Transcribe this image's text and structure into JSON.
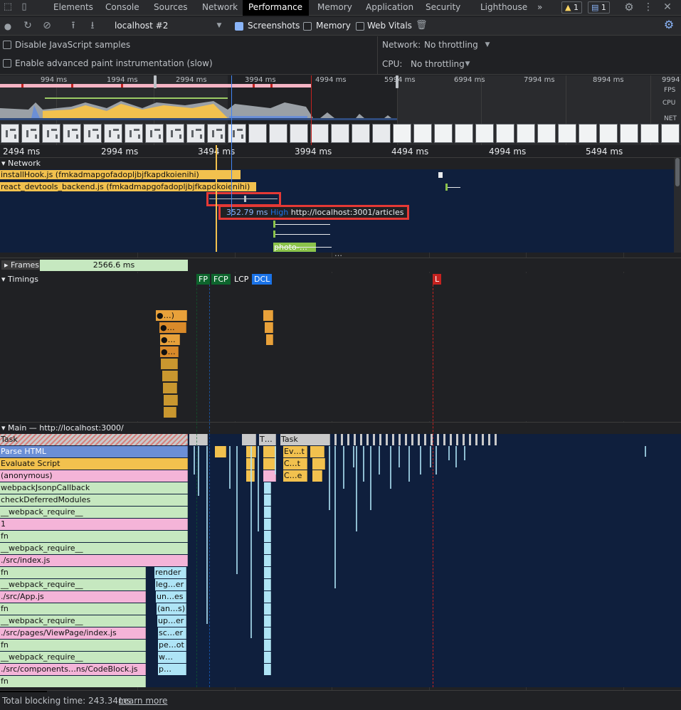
{
  "tabs": {
    "items": [
      "Elements",
      "Console",
      "Sources",
      "Network",
      "Performance",
      "Memory",
      "Application",
      "Security",
      "Lighthouse"
    ],
    "more": "»",
    "warnings_count": "1",
    "messages_count": "1"
  },
  "toolbar": {
    "target": "localhost #2",
    "screenshots_label": "Screenshots",
    "memory_label": "Memory",
    "web_vitals_label": "Web Vitals"
  },
  "settings": {
    "disable_js_samples": "Disable JavaScript samples",
    "advanced_paint": "Enable advanced paint instrumentation (slow)",
    "network_label": "Network:",
    "network_value": "No throttling",
    "cpu_label": "CPU:",
    "cpu_value": "No throttling"
  },
  "overview": {
    "ticks": [
      "994 ms",
      "1994 ms",
      "2994 ms",
      "3994 ms",
      "4994 ms",
      "5994 ms",
      "6994 ms",
      "7994 ms",
      "8994 ms",
      "9994"
    ],
    "fps_label": "FPS",
    "cpu_label": "CPU",
    "net_label": "NET"
  },
  "ruler": {
    "ticks": [
      "2494 ms",
      "2994 ms",
      "3494 ms",
      "3994 ms",
      "4494 ms",
      "4994 ms",
      "5494 ms"
    ]
  },
  "network_track": {
    "title": "Network",
    "requests": [
      {
        "label": "installHook.js (fmkadmapgofadopljbjfkapdkoienihi)"
      },
      {
        "label": "react_devtools_backend.js (fmkadmapgofadopljbjfkapdkoienihi)"
      },
      {
        "label": "photo-…"
      }
    ],
    "tooltip": {
      "duration": "352.79 ms",
      "priority": "High",
      "url": "http://localhost:3001/articles"
    },
    "more": "…"
  },
  "frames": {
    "title": "Frames",
    "value": "2566.6 ms"
  },
  "timings": {
    "title": "Timings",
    "markers": [
      "FP",
      "FCP",
      "LCP",
      "DCL",
      "L"
    ],
    "colors": {
      "FP": "#0d652d",
      "FCP": "#0d652d",
      "LCP": "#202124",
      "DCL": "#1a73e8",
      "L": "#c5221f"
    }
  },
  "main": {
    "title": "Main — http://localhost:3000/",
    "flame_rows": [
      "Task",
      "Parse HTML",
      "Evaluate Script",
      "(anonymous)",
      "webpackJsonpCallback",
      "checkDeferredModules",
      "__webpack_require__",
      "1",
      "fn",
      "__webpack_require__",
      "./src/index.js",
      "fn",
      "__webpack_require__",
      "./src/App.js",
      "fn",
      "__webpack_require__",
      "./src/pages/ViewPage/index.js",
      "fn",
      "__webpack_require__",
      "./src/components…ns/CodeBlock.js",
      "fn"
    ],
    "side_labels": [
      "render",
      "leg…er",
      "un…es",
      "(an…s)",
      "up…er",
      "sc…er",
      "pe…ot",
      "w…",
      "p…"
    ],
    "right_blocks": {
      "task2": "T…",
      "task3": "Task",
      "ev": "Ev…t",
      "c1": "C…t",
      "c2": "C…e"
    }
  },
  "status": {
    "total_blocking": "Total blocking time: 243.34ms",
    "learn_more": "Learn more"
  },
  "colors": {
    "task": "#c9c9c9",
    "parse_html": "#6b8fd6",
    "evaluate_script": "#f2c14e",
    "pink": "#f4b4d8",
    "green": "#c6e8c0",
    "light_blue": "#aee4f6",
    "network_bg": "#0f1f3d",
    "accent": "#8ab4f8"
  }
}
